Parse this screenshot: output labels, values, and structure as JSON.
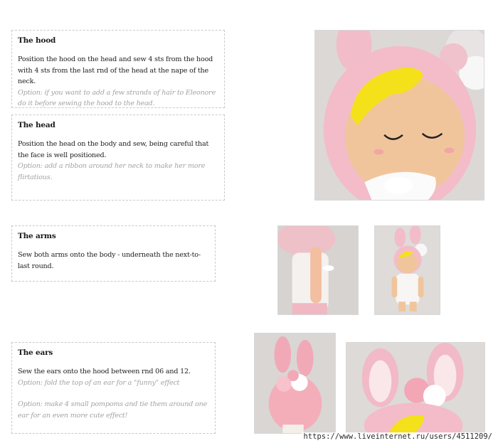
{
  "sections": {
    "hood": {
      "title": "The hood",
      "instruction": "Position the hood on the head and sew 4 sts from the hood with 4 sts from the last rnd of the head at the nape of the neck.",
      "option": "Option: if you want to add a few strands of hair to Eleonore do it before sewing the hood to the head."
    },
    "head": {
      "title": "The head",
      "instruction": "Position the head on the body and sew, being careful that the face is well positioned.",
      "option": "Option: add a ribbon around her neck to make her more flirtatious."
    },
    "arms": {
      "title": "The arms",
      "instruction": "Sew both arms onto the body - underneath the next-to-last round."
    },
    "ears": {
      "title": "The ears",
      "instruction": "Sew the ears onto the hood between rnd 06 and 12.",
      "option_1": "Option: fold the top of an ear for a \"funny\" effect",
      "option_2": "Option: make 4 small pompoms and tie them around one ear for an even more cute effect!"
    }
  },
  "watermark": "https://www.liveinternet.ru/users/4511209/",
  "photos": [
    {
      "name": "doll-face-closeup-photo"
    },
    {
      "name": "doll-side-arm-photo"
    },
    {
      "name": "doll-full-body-photo"
    },
    {
      "name": "doll-back-ears-photo"
    },
    {
      "name": "doll-ears-closeup-photo"
    }
  ],
  "colors": {
    "yarn_pink": "#f2b9c6",
    "yarn_skin": "#f2c7a0",
    "hair_yellow": "#f4e11a",
    "pompom_white": "#ffffff",
    "pompom_pink": "#f3a6b6"
  }
}
